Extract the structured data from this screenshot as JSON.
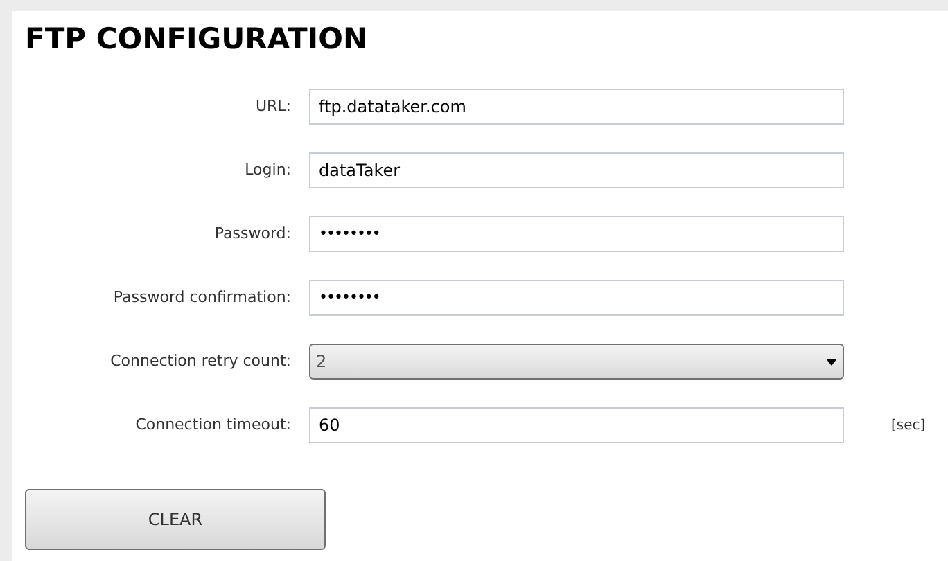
{
  "title": "FTP CONFIGURATION",
  "fields": [
    {
      "kind": "text",
      "label": "URL:",
      "value": "ftp.datataker.com"
    },
    {
      "kind": "text",
      "label": "Login:",
      "value": "dataTaker"
    },
    {
      "kind": "password",
      "label": "Password:",
      "value": "••••••••"
    },
    {
      "kind": "password",
      "label": "Password confirmation:",
      "value": "••••••••"
    },
    {
      "kind": "dropdown",
      "label": "Connection retry count:",
      "value": "2"
    },
    {
      "kind": "text",
      "label": "Connection timeout:",
      "value": "60",
      "unit": "[sec]"
    }
  ],
  "button": "CLEAR"
}
